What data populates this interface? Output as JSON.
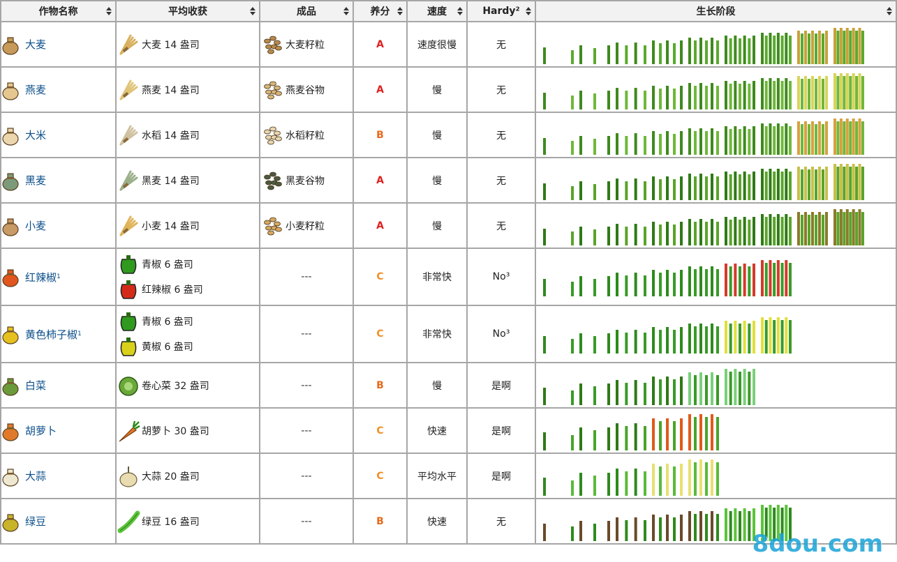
{
  "headers": {
    "name": "作物名称",
    "harvest": "平均收获",
    "product": "成品",
    "nutrient": "养分",
    "speed": "速度",
    "hardy": "Hardy²",
    "stages": "生长阶段"
  },
  "rows": [
    {
      "name": "大麦",
      "sup": "",
      "seed_color": "#c79a5a",
      "harvest": [
        {
          "text": "大麦 14 盎司",
          "icon": "wheat-bundle-icon",
          "color": "#d8b060"
        }
      ],
      "product": {
        "text": "大麦籽粒",
        "icon": "grain-icon",
        "color": "#b88a4a"
      },
      "nutrient": "A",
      "speed": "速度很慢",
      "hardy": "无",
      "stage_count": 9,
      "stage_colors": [
        "#3f8a1e",
        "#5aaa2e",
        "#c9a13a"
      ]
    },
    {
      "name": "燕麦",
      "sup": "",
      "seed_color": "#e6c690",
      "harvest": [
        {
          "text": "燕麦 14 盎司",
          "icon": "wheat-bundle-icon",
          "color": "#e0c47a"
        }
      ],
      "product": {
        "text": "燕麦谷物",
        "icon": "grain-icon",
        "color": "#d7b57a"
      },
      "nutrient": "A",
      "speed": "慢",
      "hardy": "无",
      "stage_count": 9,
      "stage_colors": [
        "#3f8a1e",
        "#6fb83a",
        "#d9d45a"
      ]
    },
    {
      "name": "大米",
      "sup": "",
      "seed_color": "#ecd6ae",
      "harvest": [
        {
          "text": "水稻 14 盎司",
          "icon": "rice-bundle-icon",
          "color": "#cfc1a0"
        }
      ],
      "product": {
        "text": "水稻籽粒",
        "icon": "rice-grain-icon",
        "color": "#e8d6b0"
      },
      "nutrient": "B",
      "speed": "慢",
      "hardy": "无",
      "stage_count": 9,
      "stage_colors": [
        "#3f8a1e",
        "#6fb83a",
        "#d9a040"
      ]
    },
    {
      "name": "黑麦",
      "sup": "",
      "seed_color": "#7c9a7a",
      "harvest": [
        {
          "text": "黑麦 14 盎司",
          "icon": "rye-bundle-icon",
          "color": "#9bb08a"
        }
      ],
      "product": {
        "text": "黑麦谷物",
        "icon": "grain-icon",
        "color": "#4a5a40"
      },
      "nutrient": "A",
      "speed": "慢",
      "hardy": "无",
      "stage_count": 9,
      "stage_colors": [
        "#2f7a16",
        "#5aa42a",
        "#c8c04a"
      ]
    },
    {
      "name": "小麦",
      "sup": "",
      "seed_color": "#c89a66",
      "harvest": [
        {
          "text": "小麦 14 盎司",
          "icon": "wheat-bundle-icon",
          "color": "#e0b45a"
        }
      ],
      "product": {
        "text": "小麦籽粒",
        "icon": "grain-icon",
        "color": "#d5a860"
      },
      "nutrient": "A",
      "speed": "慢",
      "hardy": "无",
      "stage_count": 9,
      "stage_colors": [
        "#2f7a16",
        "#5aa42a",
        "#8a7a2a"
      ]
    },
    {
      "name": "红辣椒",
      "sup": "1",
      "seed_color": "#e0561e",
      "harvest": [
        {
          "text": "青椒 6 盎司",
          "icon": "green-pepper-icon",
          "color": "#2f9a1e"
        },
        {
          "text": "红辣椒 6 盎司",
          "icon": "red-pepper-icon",
          "color": "#d42a1a"
        }
      ],
      "product": {
        "text": "---",
        "icon": "",
        "color": ""
      },
      "nutrient": "C",
      "speed": "非常快",
      "hardy": "No³",
      "stage_count": 7,
      "stage_colors": [
        "#2f8a1e",
        "#3a9a28",
        "#d43a2a"
      ]
    },
    {
      "name": "黄色柿子椒",
      "sup": "1",
      "seed_color": "#e6c01e",
      "harvest": [
        {
          "text": "青椒 6 盎司",
          "icon": "green-pepper-icon",
          "color": "#2f9a1e"
        },
        {
          "text": "黄椒 6 盎司",
          "icon": "yellow-pepper-icon",
          "color": "#d8d01a"
        }
      ],
      "product": {
        "text": "---",
        "icon": "",
        "color": ""
      },
      "nutrient": "C",
      "speed": "非常快",
      "hardy": "No³",
      "stage_count": 7,
      "stage_colors": [
        "#2f8a1e",
        "#3a9a28",
        "#e0e03a"
      ]
    },
    {
      "name": "白菜",
      "sup": "",
      "seed_color": "#6a9a3a",
      "harvest": [
        {
          "text": "卷心菜 32 盎司",
          "icon": "cabbage-icon",
          "color": "#6aa83a"
        }
      ],
      "product": {
        "text": "---",
        "icon": "",
        "color": ""
      },
      "nutrient": "B",
      "speed": "慢",
      "hardy": "是啊",
      "stage_count": 6,
      "stage_colors": [
        "#2f7a16",
        "#3a9a28",
        "#7ad07a"
      ]
    },
    {
      "name": "胡萝卜",
      "sup": "",
      "seed_color": "#e07a2a",
      "harvest": [
        {
          "text": "胡萝卜 30 盎司",
          "icon": "carrot-icon",
          "color": "#e07a22"
        }
      ],
      "product": {
        "text": "---",
        "icon": "",
        "color": ""
      },
      "nutrient": "C",
      "speed": "快速",
      "hardy": "是啊",
      "stage_count": 5,
      "stage_colors": [
        "#2f7a16",
        "#4aa42a",
        "#e05a1a"
      ]
    },
    {
      "name": "大蒜",
      "sup": "",
      "seed_color": "#efe8d0",
      "harvest": [
        {
          "text": "大蒜 20 盎司",
          "icon": "garlic-icon",
          "color": "#e8dcb0"
        }
      ],
      "product": {
        "text": "---",
        "icon": "",
        "color": ""
      },
      "nutrient": "C",
      "speed": "平均水平",
      "hardy": "是啊",
      "stage_count": 5,
      "stage_colors": [
        "#2f8a1e",
        "#5aba3a",
        "#e8e070"
      ]
    },
    {
      "name": "绿豆",
      "sup": "",
      "seed_color": "#c8b42a",
      "harvest": [
        {
          "text": "绿豆 16 盎司",
          "icon": "green-bean-icon",
          "color": "#5ac43a"
        }
      ],
      "product": {
        "text": "---",
        "icon": "",
        "color": ""
      },
      "nutrient": "B",
      "speed": "快速",
      "hardy": "无",
      "stage_count": 7,
      "stage_colors": [
        "#6a4a2a",
        "#2f8a1e",
        "#5ac43a"
      ]
    }
  ],
  "colors": {
    "A": "#e02020",
    "B": "#e86a1a",
    "C": "#f0902a",
    "link": "#0b4f8a",
    "border": "#a6a6a6",
    "header_bg": "#f2f2f2"
  },
  "watermark": "8dou.com"
}
